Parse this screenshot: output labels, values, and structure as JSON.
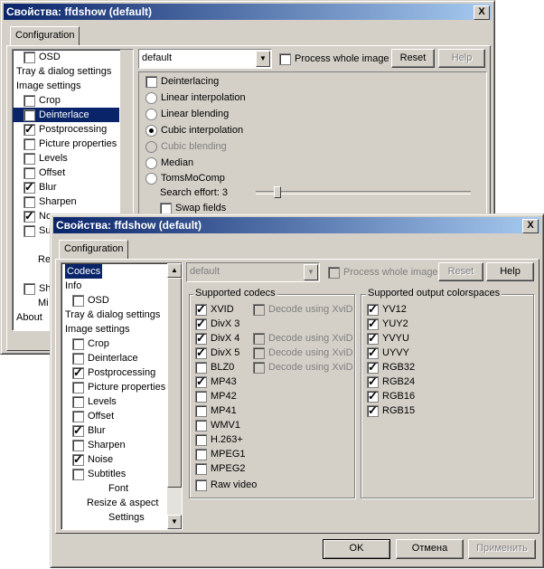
{
  "back_window": {
    "title": "Свойства: ffdshow (default)",
    "close_label": "X",
    "tab": "Configuration",
    "preset": "default",
    "process_whole_image": "Process whole image",
    "reset": "Reset",
    "help": "Help",
    "tree": [
      "OSD",
      "Tray & dialog settings",
      "Image settings",
      "Crop",
      "Deinterlace",
      "Postprocessing",
      "Picture properties",
      "Levels",
      "Offset",
      "Blur",
      "Sharpen",
      "No",
      "Su",
      "Re",
      "Sh",
      "Mi",
      "About"
    ],
    "deint": {
      "title": "Deinterlacing",
      "options": [
        "Linear interpolation",
        "Linear blending",
        "Cubic interpolation",
        "Cubic blending",
        "Median",
        "TomsMoComp"
      ],
      "search_effort": "Search effort: 3",
      "search_effort_level": 3,
      "swap_fields": "Swap fields"
    }
  },
  "front_window": {
    "title": "Свойства: ffdshow (default)",
    "close_label": "X",
    "tab": "Configuration",
    "preset": "default",
    "process_whole_image": "Process whole image",
    "reset": "Reset",
    "help": "Help",
    "tree": [
      "Codecs",
      "Info",
      "OSD",
      "Tray & dialog settings",
      "Image settings",
      "Crop",
      "Deinterlace",
      "Postprocessing",
      "Picture properties",
      "Levels",
      "Offset",
      "Blur",
      "Sharpen",
      "Noise",
      "Subtitles",
      "Font",
      "Resize & aspect",
      "Settings"
    ],
    "codecs_group": "Supported codecs",
    "codecs": [
      "XVID",
      "DivX 3",
      "DivX 4",
      "DivX 5",
      "BLZ0",
      "MP43",
      "MP42",
      "MP41",
      "WMV1",
      "H.263+",
      "MPEG1",
      "MPEG2",
      "Raw video"
    ],
    "decode_xvid": "Decode using XviD",
    "colorspaces_group": "Supported output colorspaces",
    "colorspaces": [
      "YV12",
      "YUY2",
      "YVYU",
      "UYVY",
      "RGB32",
      "RGB24",
      "RGB16",
      "RGB15"
    ],
    "ok": "OK",
    "cancel": "Отмена",
    "apply": "Применить"
  },
  "colors": {
    "title_start": "#0a246a",
    "title_end": "#a6caf0",
    "face": "#d4d0c8",
    "selection": "#0a246a"
  }
}
